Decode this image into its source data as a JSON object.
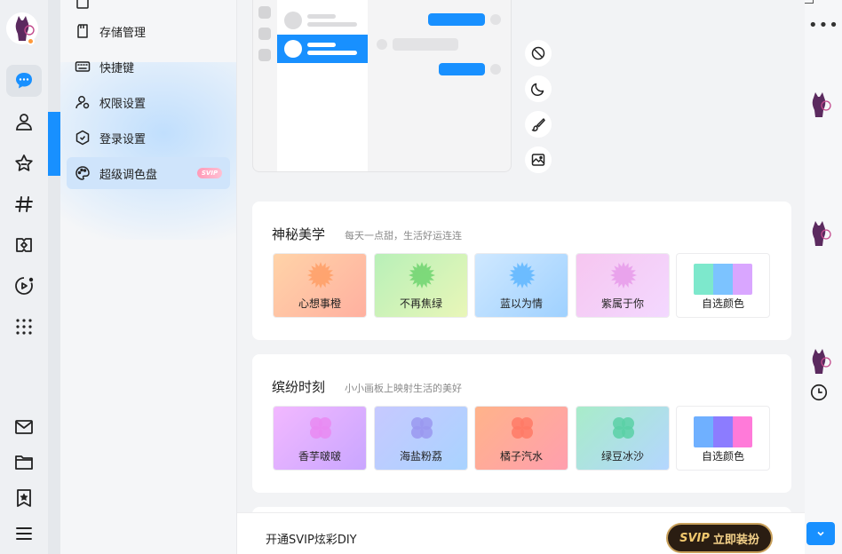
{
  "sidebar": {
    "items": [
      {
        "label": "存储管理",
        "icon": "storage-icon"
      },
      {
        "label": "快捷键",
        "icon": "keyboard-icon"
      },
      {
        "label": "权限设置",
        "icon": "user-permission-icon"
      },
      {
        "label": "登录设置",
        "icon": "shield-hexagon-icon"
      },
      {
        "label": "超级调色盘",
        "icon": "palette-icon",
        "badge": "SVIP",
        "active": true
      }
    ]
  },
  "preview": {
    "tools": [
      "ban-icon",
      "moon-icon",
      "brush-icon",
      "image-icon"
    ]
  },
  "themes": [
    {
      "title": "神秘美学",
      "subtitle": "每天一点甜，生活好运连连",
      "swatches": [
        {
          "label": "心想事橙",
          "from": "#ffd3a8",
          "to": "#ffb0a0",
          "accent": "#ff9f66"
        },
        {
          "label": "不再焦绿",
          "from": "#b8f0b8",
          "to": "#e9f6b8",
          "accent": "#6fd46f"
        },
        {
          "label": "蓝以为情",
          "from": "#cfe8ff",
          "to": "#9fd1ff",
          "accent": "#5eb6ff"
        },
        {
          "label": "紫属于你",
          "from": "#f6c6f0",
          "to": "#f3d8ff",
          "accent": "#e69bea"
        }
      ],
      "custom": {
        "label": "自选颜色",
        "colors": [
          "#7de8cc",
          "#7cc3ff",
          "#d9a6ff"
        ]
      }
    },
    {
      "title": "缤纷时刻",
      "subtitle": "小小画板上映射生活的美好",
      "swatches": [
        {
          "label": "香芋啵啵",
          "from": "#f2b8ff",
          "to": "#c9a6ff",
          "accent": "#e98af2"
        },
        {
          "label": "海盐粉荔",
          "from": "#c7c9ff",
          "to": "#a9d3ff",
          "accent": "#9a98f0"
        },
        {
          "label": "橘子汽水",
          "from": "#ffb38a",
          "to": "#ff9fae",
          "accent": "#ff7a66"
        },
        {
          "label": "绿豆冰沙",
          "from": "#a8ecc9",
          "to": "#b4d6ff",
          "accent": "#5bd0a6"
        }
      ],
      "custom": {
        "label": "自选颜色",
        "colors": [
          "#6fb0ff",
          "#8c7cff",
          "#ff7ad9"
        ]
      }
    }
  ],
  "bottom": {
    "text": "开通SVIP炫彩DIY",
    "button_tag": "SVIP",
    "button_label": "立即装扮"
  },
  "colors": {
    "accent": "#1890ff",
    "active_nav": "#cfe4fb"
  }
}
